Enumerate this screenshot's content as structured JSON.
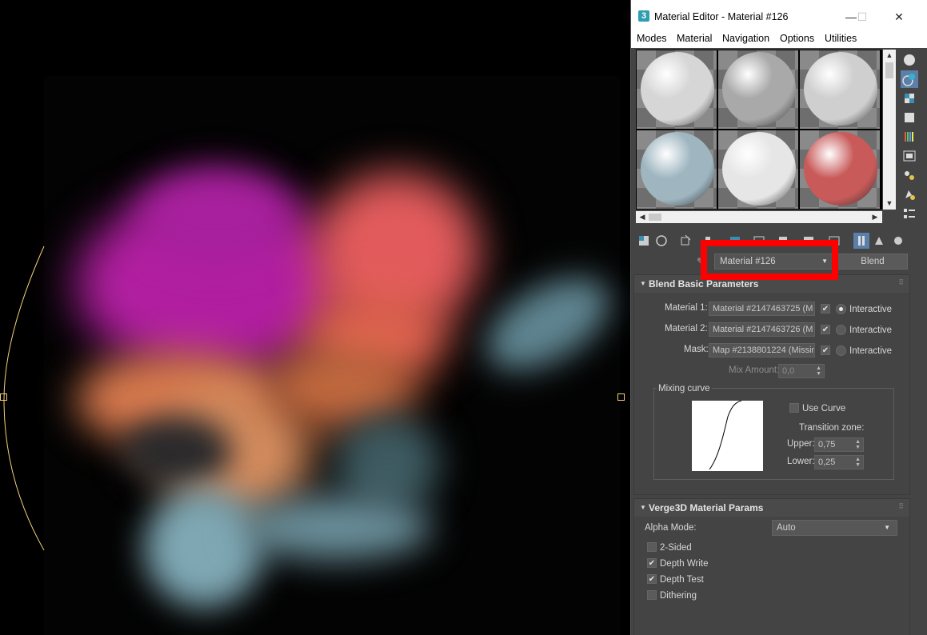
{
  "window": {
    "title": "Material Editor - Material #126",
    "minimize": "—",
    "maximize": "☐",
    "close": "✕"
  },
  "menu": {
    "items": [
      "Modes",
      "Material",
      "Navigation",
      "Options",
      "Utilities"
    ]
  },
  "slots": {
    "colors": [
      "#d6d6d6",
      "#a9a9a9",
      "#cfcfcf",
      "#9fb6c1",
      "#e6e6e6",
      "#c95a5a"
    ],
    "selected_index": 0
  },
  "name_row": {
    "material_name": "Material #126",
    "material_type": "Blend"
  },
  "blend_params": {
    "title": "Blend Basic Parameters",
    "material1_label": "Material 1:",
    "material1_value": "Material #2147463725  (M",
    "material2_label": "Material 2:",
    "material2_value": "Material #2147463726  (M",
    "mask_label": "Mask:",
    "mask_value": "Map #2138801224  (Missin",
    "interactive_label": "Interactive",
    "mix_amount_label": "Mix Amount:",
    "mix_amount_value": "0,0",
    "mixing_curve_label": "Mixing curve",
    "use_curve_label": "Use Curve",
    "transition_zone_label": "Transition zone:",
    "upper_label": "Upper:",
    "upper_value": "0,75",
    "lower_label": "Lower:",
    "lower_value": "0,25"
  },
  "verge3d": {
    "title": "Verge3D Material Params",
    "alpha_mode_label": "Alpha Mode:",
    "alpha_mode_value": "Auto",
    "two_sided_label": "2-Sided",
    "two_sided": false,
    "depth_write_label": "Depth Write",
    "depth_write": true,
    "depth_test_label": "Depth Test",
    "depth_test": true,
    "dithering_label": "Dithering",
    "dithering": false
  },
  "highlight_color": "#ff0000"
}
